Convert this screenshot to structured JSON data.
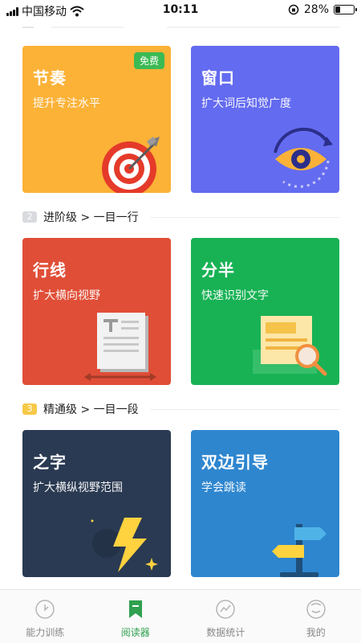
{
  "status_bar": {
    "carrier": "中国移动",
    "time": "10:11",
    "battery": "28%",
    "battery_level": 0.28
  },
  "colors": {
    "yellow": "#fbb237",
    "indigo": "#636bf0",
    "red": "#e04e37",
    "green": "#18b255",
    "navy": "#2a3a52",
    "blue": "#2e86cf",
    "badge": "#3cba54",
    "active_tab": "#2fa04f"
  },
  "cards": [
    {
      "title": "节奏",
      "subtitle": "提升专注水平",
      "badge": "免费",
      "icon": "target-icon"
    },
    {
      "title": "窗口",
      "subtitle": "扩大词后知觉广度",
      "icon": "eye-icon"
    },
    {
      "title": "行线",
      "subtitle": "扩大横向视野",
      "icon": "document-icon"
    },
    {
      "title": "分半",
      "subtitle": "快速识别文字",
      "icon": "magnifier-icon"
    },
    {
      "title": "之字",
      "subtitle": "扩大横纵视野范围",
      "icon": "lightning-icon"
    },
    {
      "title": "双边引导",
      "subtitle": "学会跳读",
      "icon": "signpost-icon"
    }
  ],
  "sections": [
    {
      "number": "2",
      "label": "进阶级 > 一目一行"
    },
    {
      "number": "3",
      "label": "精通级 > 一目一段"
    }
  ],
  "tabbar": {
    "items": [
      {
        "label": "能力训练",
        "icon": "clock-icon"
      },
      {
        "label": "阅读器",
        "icon": "bookmark-icon",
        "active": true
      },
      {
        "label": "数据统计",
        "icon": "chart-icon"
      },
      {
        "label": "我的",
        "icon": "smile-icon"
      }
    ]
  }
}
